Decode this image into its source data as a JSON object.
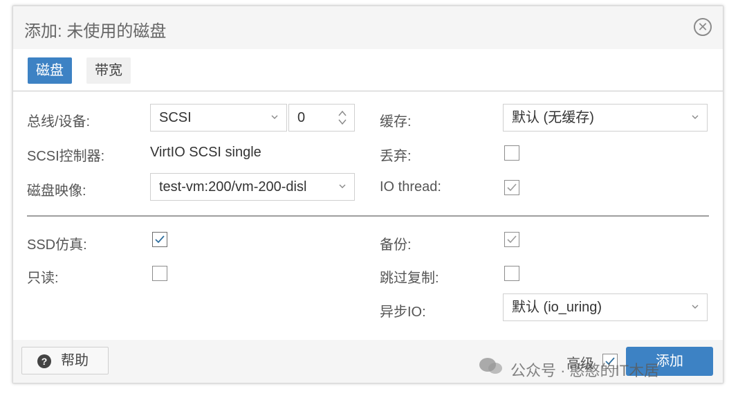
{
  "dialog": {
    "title": "添加: 未使用的磁盘"
  },
  "tabs": [
    {
      "label": "磁盘",
      "active": true
    },
    {
      "label": "带宽",
      "active": false
    }
  ],
  "left": {
    "bus_label": "总线/设备:",
    "bus_value": "SCSI",
    "device_value": "0",
    "controller_label": "SCSI控制器:",
    "controller_value": "VirtIO SCSI single",
    "image_label": "磁盘映像:",
    "image_value": "test-vm:200/vm-200-disl",
    "ssd_label": "SSD仿真:",
    "ssd_checked": true,
    "readonly_label": "只读:",
    "readonly_checked": false
  },
  "right": {
    "cache_label": "缓存:",
    "cache_value": "默认 (无缓存)",
    "discard_label": "丢弃:",
    "discard_checked": false,
    "iothread_label": "IO thread:",
    "iothread_checked": true,
    "backup_label": "备份:",
    "backup_checked": true,
    "skip_repl_label": "跳过复制:",
    "skip_repl_checked": false,
    "async_io_label": "异步IO:",
    "async_io_value": "默认 (io_uring)"
  },
  "footer": {
    "help_label": "帮助",
    "advanced_label": "高级",
    "advanced_checked": true,
    "add_label": "添加"
  },
  "watermark": "公众号 · 憨憨的IT木居",
  "colors": {
    "accent": "#3d82c4",
    "titlebar_bg": "#f5f5f5",
    "checkmark_enabled": "#2e6e9e",
    "checkmark_disabled": "#9a9a9a"
  },
  "icons": {
    "close": "close-circle-icon",
    "help": "question-circle-icon",
    "dropdown": "chevron-down-icon",
    "spinner": "spinner-arrows-icon",
    "watermark": "wechat-icon"
  }
}
